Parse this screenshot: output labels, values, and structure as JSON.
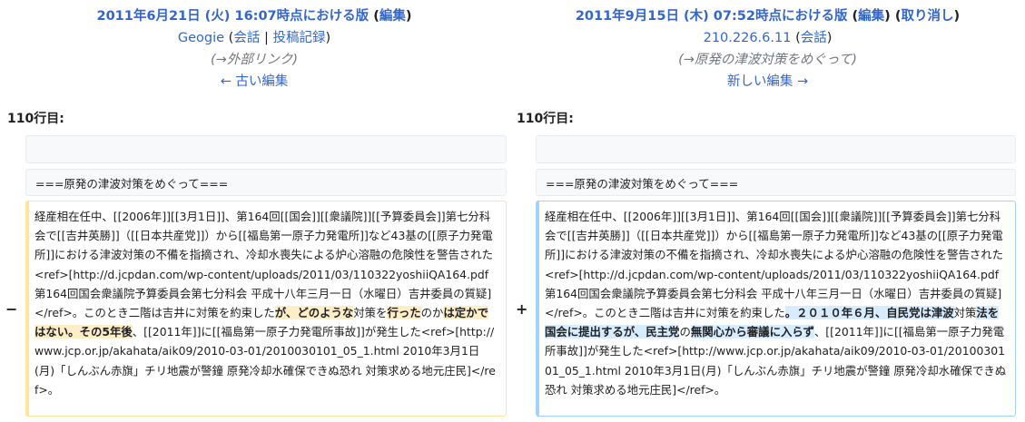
{
  "left_header": {
    "title": "2011年6月21日 (火) 16:07時点における版",
    "edit": "編集",
    "user": "Geogie",
    "talk": "会話",
    "contribs": "投稿記録",
    "comment": "(→外部リンク)",
    "nav": "← 古い編集"
  },
  "right_header": {
    "title": "2011年9月15日 (木) 07:52時点における版",
    "edit": "編集",
    "undo": "取り消し",
    "user": "210.226.6.11",
    "talk": "会話",
    "comment": "(→原発の津波対策をめぐって)",
    "nav": "新しい編集 →"
  },
  "line_label": "110行目:",
  "context_line": "===原発の津波対策をめぐって===",
  "del_marker": "−",
  "add_marker": "+",
  "diff": {
    "common_before": "経産相在任中、[[2006年]][[3月1日]]、第164回[[国会]][[衆議院]][[予算委員会]]第七分科会で[[吉井英勝]]（[[日本共産党]]）から[[福島第一原子力発電所]]など43基の[[原子力発電所]]における津波対策の不備を指摘され、冷却水喪失による炉心溶融の危険性を警告された<ref>[http://d.jcpdan.com/wp-content/uploads/2011/03/110322yoshiiQA164.pdf 第164回国会衆議院予算委員会第七分科会 平成十八年三月一日（水曜日）吉井委員の質疑]</ref>。このとき二階は吉井に対策を約束した",
    "del_1": "が、どのような",
    "del_2": "対策を",
    "del_3": "行った",
    "del_4": "のか",
    "del_5": "は定かではない。その5年後",
    "add_1": "。２０１０年６月、自民党は津波",
    "add_2": "対策",
    "add_3": "法を国会に提出するが、民主党",
    "add_4": "の",
    "add_5": "無関心から審議に入らず",
    "common_after_left": "、[[2011年]]に[[福島第一原子力発電所事故]]が発生した<ref>[http://www.jcp.or.jp/akahata/aik09/2010-03-01/2010030101_05_1.html 2010年3月1日(月)「しんぶん赤旗」チリ地震が警鐘 原発冷却水確保できぬ恐れ 対策求める地元庄民]</ref>。",
    "common_after_right": "、[[2011年]]に[[福島第一原子力発電所事故]]が発生した<ref>[http://www.jcp.or.jp/akahata/aik09/2010-03-01/2010030101_05_1.html 2010年3月1日(月)「しんぶん赤旗」チリ地震が警鐘 原発冷却水確保できぬ恐れ 対策求める地元庄民]</ref>。"
  }
}
